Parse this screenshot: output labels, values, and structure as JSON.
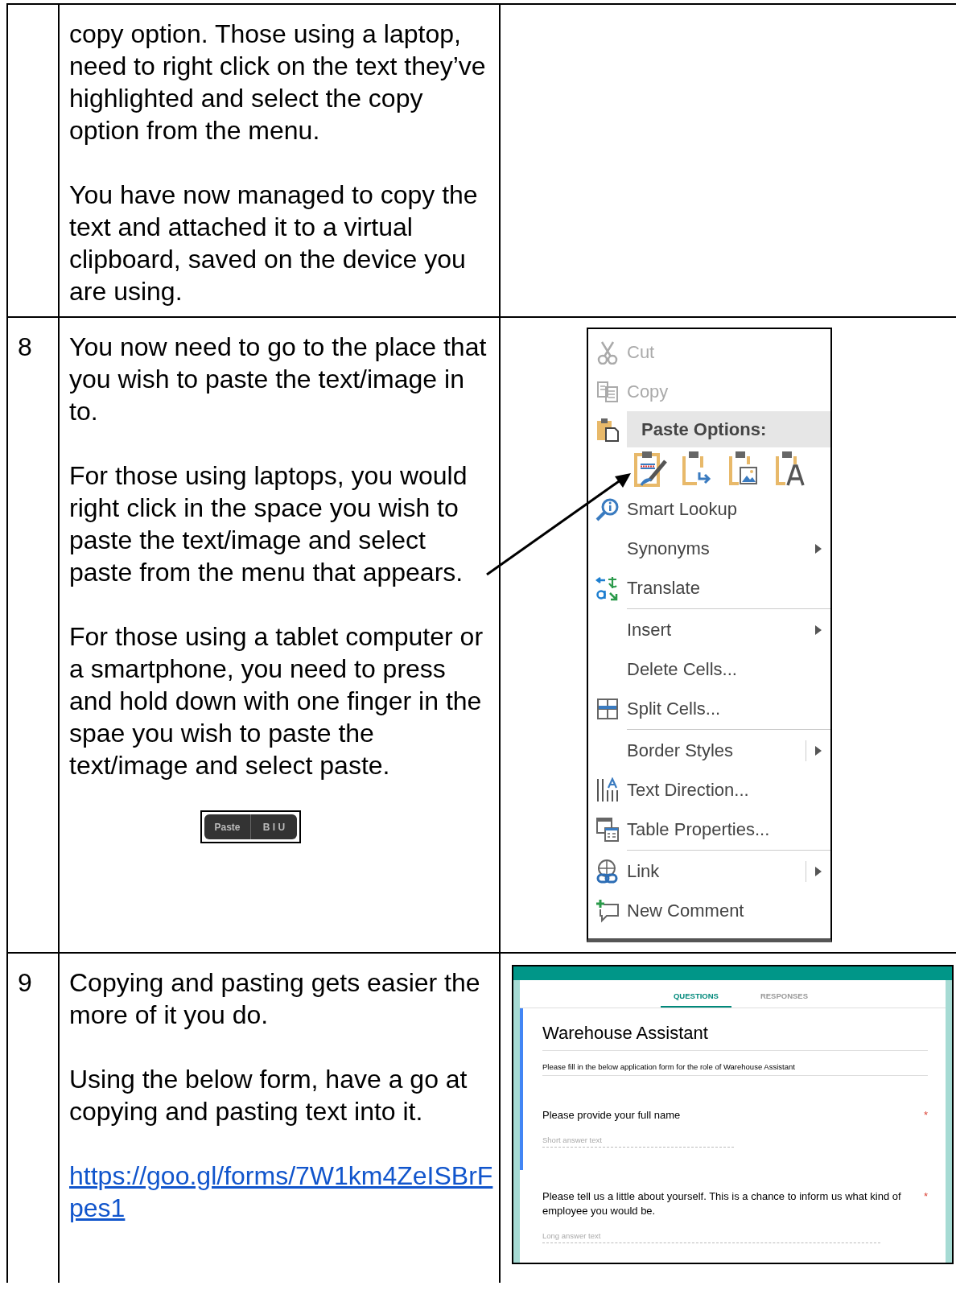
{
  "rows": [
    {
      "paragraphs": [
        "copy option. Those using a laptop, need to right click on the text they’ve highlighted and select the copy option from the menu.",
        "You have now managed to copy the text and attached it to a virtual clipboard, saved on the device you are using."
      ]
    },
    {
      "number": "8",
      "paragraphs": [
        "You now need to go to the place that you wish to paste the text/image in to.",
        "For those using laptops, you would right click in the space you wish to paste the text/image and select paste from the menu that appears.",
        "For those using a tablet computer or a smartphone, you need to press and hold down with one finger in the spae you wish to paste the text/image and select paste."
      ],
      "paste_bar": {
        "buttons": [
          "Paste",
          "B I U"
        ]
      },
      "context_menu": {
        "items": [
          {
            "kind": "item",
            "label": "Cut",
            "disabled": true,
            "submenu": false,
            "split": false
          },
          {
            "kind": "item",
            "label": "Copy",
            "disabled": true,
            "submenu": false,
            "split": false
          },
          {
            "kind": "header",
            "label": "Paste Options:"
          },
          {
            "kind": "paste_icons"
          },
          {
            "kind": "item",
            "label": "Smart Lookup",
            "disabled": false,
            "submenu": false,
            "split": false
          },
          {
            "kind": "item",
            "label": "Synonyms",
            "disabled": false,
            "submenu": true,
            "split": false
          },
          {
            "kind": "item",
            "label": "Translate",
            "disabled": false,
            "submenu": false,
            "split": false
          },
          {
            "kind": "separator"
          },
          {
            "kind": "item",
            "label": "Insert",
            "disabled": false,
            "submenu": true,
            "split": false
          },
          {
            "kind": "item",
            "label": "Delete Cells...",
            "disabled": false,
            "submenu": false,
            "split": false
          },
          {
            "kind": "item",
            "label": "Split Cells...",
            "disabled": false,
            "submenu": false,
            "split": false
          },
          {
            "kind": "separator"
          },
          {
            "kind": "item",
            "label": "Border Styles",
            "disabled": false,
            "submenu": true,
            "split": true
          },
          {
            "kind": "item",
            "label": "Text Direction...",
            "disabled": false,
            "submenu": false,
            "split": false
          },
          {
            "kind": "item",
            "label": "Table Properties...",
            "disabled": false,
            "submenu": false,
            "split": false
          },
          {
            "kind": "separator"
          },
          {
            "kind": "item",
            "label": "Link",
            "disabled": false,
            "submenu": true,
            "split": true
          },
          {
            "kind": "item",
            "label": "New Comment",
            "disabled": false,
            "submenu": false,
            "split": false
          }
        ]
      }
    },
    {
      "number": "9",
      "paragraphs": [
        "Copying and pasting gets easier the more of it you do.",
        "Using the below form, have a go at copying and pasting text into it."
      ],
      "link": "https://goo.gl/forms/7W1km4ZeISBrFpes1",
      "form": {
        "tabs": [
          {
            "label": "QUESTIONS",
            "selected": true
          },
          {
            "label": "RESPONSES",
            "selected": false
          }
        ],
        "title": "Warehouse Assistant",
        "description": "Please fill in the below application form for the role of Warehouse Assistant",
        "questions": [
          {
            "text": "Please provide your full name",
            "required_mark": "*",
            "placeholder": "Short answer text",
            "kind": "short"
          },
          {
            "text": "Please tell us a little about yourself. This is a chance to inform us what kind of employee you would be.",
            "required_mark": "*",
            "placeholder": "Long answer text",
            "kind": "long"
          }
        ]
      }
    }
  ]
}
